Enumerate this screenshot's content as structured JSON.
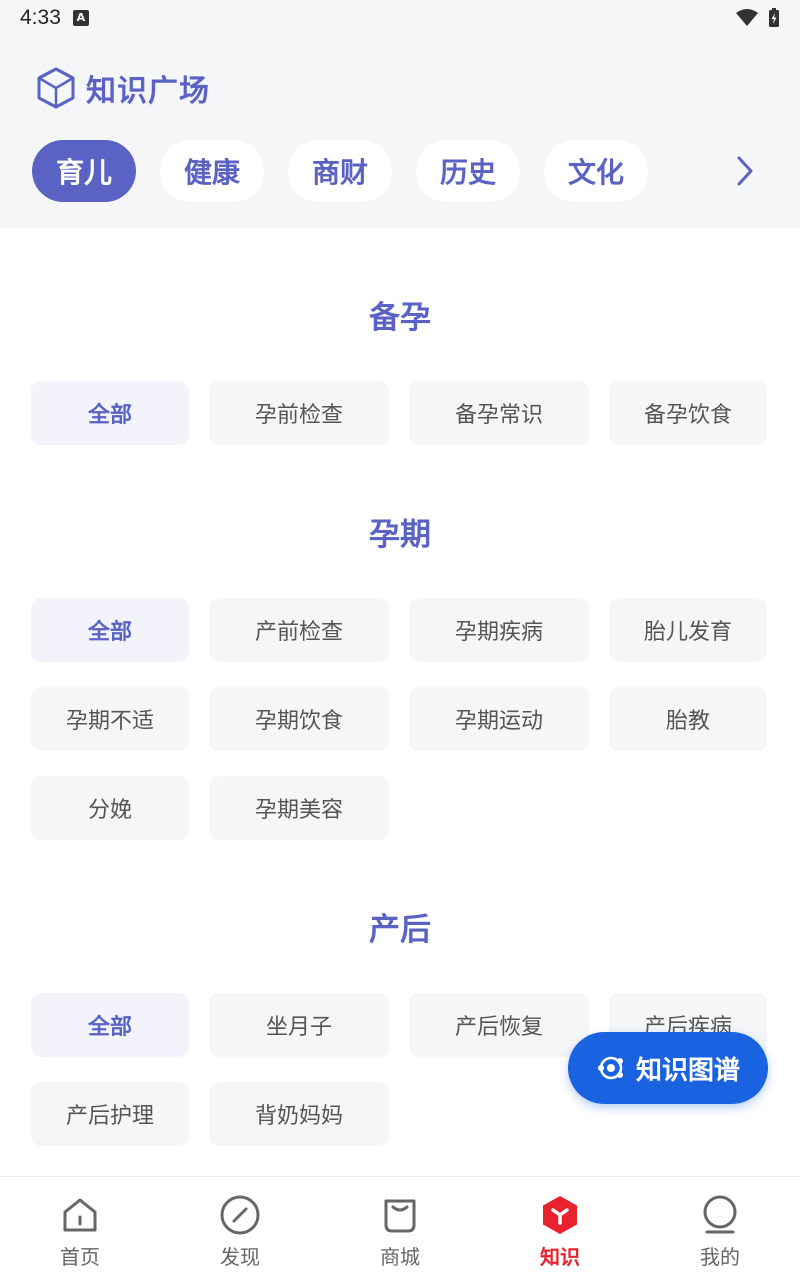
{
  "status_bar": {
    "time": "4:33",
    "a_badge": "A"
  },
  "header": {
    "title": "知识广场"
  },
  "tabs": [
    {
      "label": "育儿",
      "active": true
    },
    {
      "label": "健康",
      "active": false
    },
    {
      "label": "商财",
      "active": false
    },
    {
      "label": "历史",
      "active": false
    },
    {
      "label": "文化",
      "active": false
    }
  ],
  "sections": [
    {
      "title": "备孕",
      "items": [
        "全部",
        "孕前检查",
        "备孕常识",
        "备孕饮食"
      ]
    },
    {
      "title": "孕期",
      "items": [
        "全部",
        "产前检查",
        "孕期疾病",
        "胎儿发育",
        "孕期不适",
        "孕期饮食",
        "孕期运动",
        "胎教",
        "分娩",
        "孕期美容"
      ]
    },
    {
      "title": "产后",
      "items": [
        "全部",
        "坐月子",
        "产后恢复",
        "产后疾病",
        "产后护理",
        "背奶妈妈"
      ]
    }
  ],
  "fab": {
    "label": "知识图谱"
  },
  "bottom_nav": [
    {
      "label": "首页",
      "icon": "home-icon",
      "active": false
    },
    {
      "label": "发现",
      "icon": "compass-icon",
      "active": false
    },
    {
      "label": "商城",
      "icon": "bag-icon",
      "active": false
    },
    {
      "label": "知识",
      "icon": "knowledge-icon",
      "active": true
    },
    {
      "label": "我的",
      "icon": "profile-icon",
      "active": false
    }
  ],
  "colors": {
    "accent": "#5a62c4",
    "fab": "#1a63e0",
    "nav_active": "#e8232e"
  }
}
